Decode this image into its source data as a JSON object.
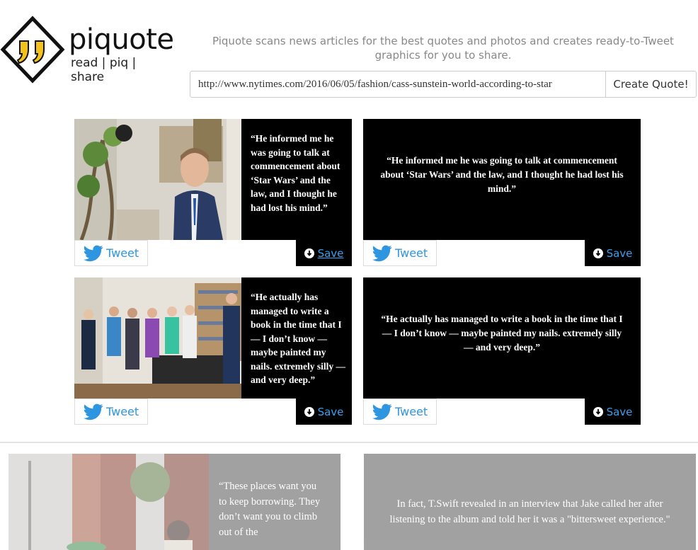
{
  "brand": {
    "name": "piquote",
    "tagline": "read | piq | share",
    "accent": "#f2c21b"
  },
  "header": {
    "description": "Piquote scans news articles for the best quotes and photos and creates ready-to-Tweet graphics for you to share."
  },
  "url_form": {
    "value": "http://www.nytimes.com/2016/06/05/fashion/cass-sunstein-world-according-to-star",
    "button_label": "Create Quote!"
  },
  "cards": [
    {
      "quote": "“He informed me he was going to talk at commencement about ‘Star Wars’ and the law, and I thought he had lost his mind.”",
      "tweet_label": "Tweet",
      "save_label": "Save"
    },
    {
      "quote": "“He informed me he was going to talk at commencement about ‘Star Wars’ and the law, and I thought he had lost his mind.”",
      "tweet_label": "Tweet",
      "save_label": "Save"
    },
    {
      "quote": "“He actually has managed to write a book in the time that I — I don’t know — maybe painted my nails. extremely silly — and very deep.”",
      "tweet_label": "Tweet",
      "save_label": "Save"
    },
    {
      "quote": "“He actually has managed to write a book in the time that I — I don’t know — maybe painted my nails. extremely silly — and very deep.”",
      "tweet_label": "Tweet",
      "save_label": "Save"
    }
  ],
  "faded_cards": [
    {
      "quote": "“These places want you to keep borrowing. They don’t want you to climb out of the"
    },
    {
      "quote": "In fact, T.Swift revealed in an interview that Jake called her after listening to the album and told her it was a \"bittersweet experience.\""
    }
  ],
  "colors": {
    "tweet_blue": "#2e95e0",
    "save_blue": "#3aa0f0"
  }
}
